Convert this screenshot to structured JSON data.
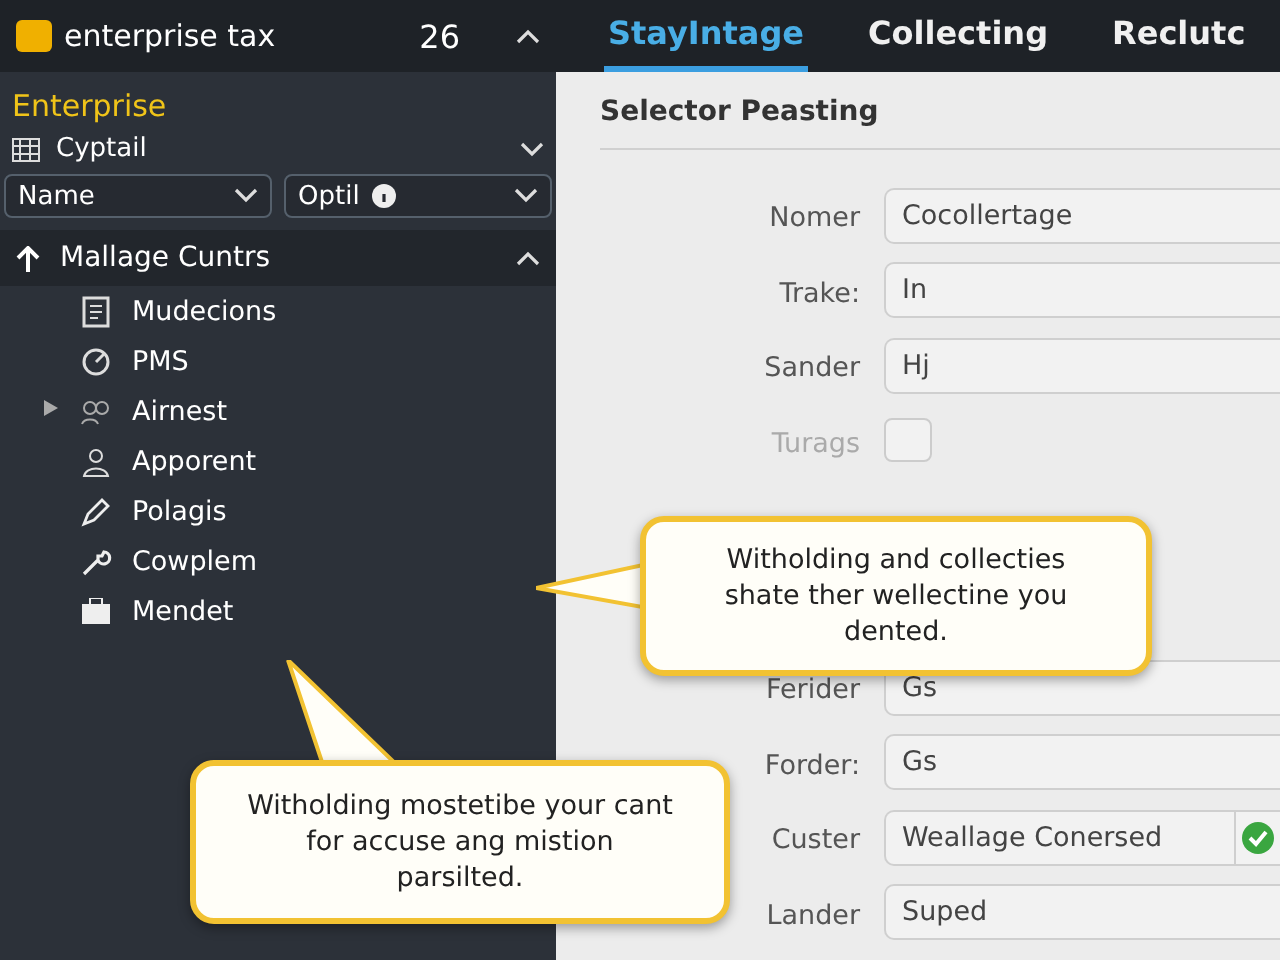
{
  "app": {
    "title": "enterprise tax",
    "count": "26",
    "expanded": true
  },
  "sidebar": {
    "section_label": "Enterprise",
    "company": {
      "label": "Cyptail"
    },
    "filters": [
      {
        "label": "Name",
        "info": false
      },
      {
        "label": "Optil",
        "info": true
      }
    ],
    "group": {
      "label": "Mallage Cuntrs",
      "expanded": true,
      "items": [
        {
          "label": "Mudecions",
          "has_caret": false
        },
        {
          "label": "PMS",
          "has_caret": false
        },
        {
          "label": "Airnest",
          "has_caret": true
        },
        {
          "label": "Apporent",
          "has_caret": false
        },
        {
          "label": "Polagis",
          "has_caret": false
        },
        {
          "label": "Cowplem",
          "has_caret": false
        },
        {
          "label": "Mendet",
          "has_caret": false
        }
      ]
    }
  },
  "tabs": [
    {
      "label": "StayIntage",
      "selected": true
    },
    {
      "label": "Collecting",
      "selected": false
    },
    {
      "label": "Reclutc",
      "selected": false
    }
  ],
  "form": {
    "title": "Selector Peasting",
    "fields": [
      {
        "kind": "text",
        "label": "Nomer",
        "value": "Cocollertage"
      },
      {
        "kind": "text",
        "label": "Trake:",
        "value": "In"
      },
      {
        "kind": "text",
        "label": "Sander",
        "value": "Hj"
      },
      {
        "kind": "checkbox",
        "label": "Turags",
        "checked": false
      },
      {
        "kind": "gap"
      },
      {
        "kind": "text",
        "label": "Ferider",
        "value": "Gs"
      },
      {
        "kind": "text",
        "label": "Forder:",
        "value": "Gs"
      },
      {
        "kind": "text",
        "label": "Custer",
        "value": "Weallage Conersed",
        "verified": true
      },
      {
        "kind": "text",
        "label": "Lander",
        "value": "Suped"
      }
    ]
  },
  "callouts": [
    {
      "text": "Witholding and collecties shate ther wellectine you dented."
    },
    {
      "text": "Witholding mostetibe your cant for accuse ang mistion parsilted."
    }
  ]
}
